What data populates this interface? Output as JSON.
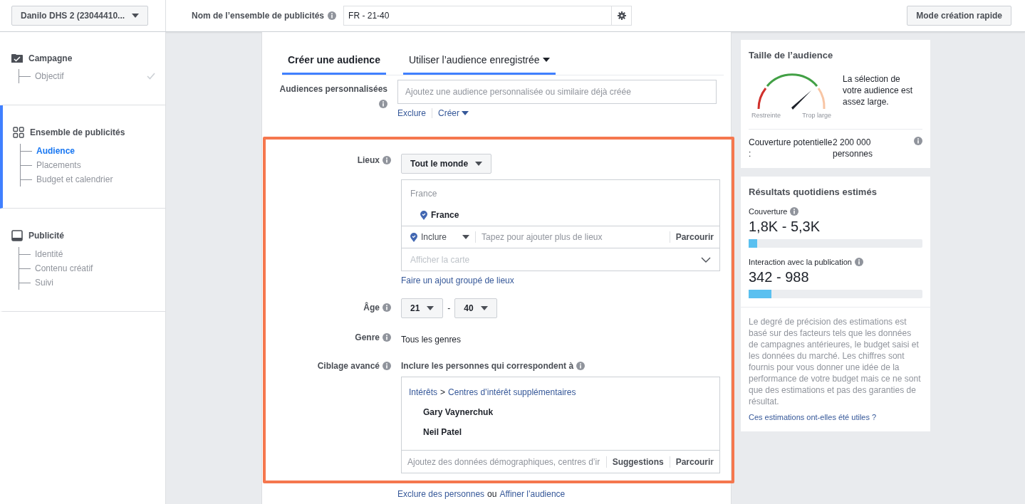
{
  "top_bar": {
    "account_selector": "Danilo DHS 2 (23044410...",
    "name_label": "Nom de l’ensemble de publicités",
    "name_value": "FR - 21-40",
    "quick_button": "Mode création rapide"
  },
  "sidebar": {
    "sections": [
      {
        "kind": "campaign",
        "title": "Campagne",
        "active": false,
        "items": [
          {
            "label": "Objectif",
            "selected": false,
            "done": true
          }
        ]
      },
      {
        "kind": "adset",
        "title": "Ensemble de publicités",
        "active": true,
        "items": [
          {
            "label": "Audience",
            "selected": true,
            "done": false
          },
          {
            "label": "Placements",
            "selected": false,
            "done": false
          },
          {
            "label": "Budget et calendrier",
            "selected": false,
            "done": false
          }
        ]
      },
      {
        "kind": "ad",
        "title": "Publicité",
        "active": false,
        "items": [
          {
            "label": "Identité",
            "selected": false,
            "done": false
          },
          {
            "label": "Contenu créatif",
            "selected": false,
            "done": false
          },
          {
            "label": "Suivi",
            "selected": false,
            "done": false
          }
        ]
      }
    ]
  },
  "audience": {
    "tabs": [
      {
        "label": "Créer une audience",
        "selected": true,
        "underlined": true,
        "dropdown": false
      },
      {
        "label": "Utiliser l’audience enregistrée",
        "selected": false,
        "underlined": true,
        "dropdown": true
      }
    ],
    "custom_audiences": {
      "label": "Audiences personnalisées",
      "placeholder": "Ajoutez une audience personnalisée ou similaire déjà créée",
      "exclude_link": "Exclure",
      "create_link": "Créer"
    },
    "locations": {
      "label": "Lieux",
      "dropdown": "Tout le monde",
      "group_header": "France",
      "selected_location": "France",
      "include": "Inclure",
      "placeholder": "Tapez pour ajouter plus de lieux",
      "browse": "Parcourir",
      "map": "Afficher la carte",
      "bulk_link": "Faire un ajout groupé de lieux"
    },
    "age": {
      "label": "Âge",
      "min": "21",
      "separator": "-",
      "max": "40"
    },
    "gender": {
      "label": "Genre",
      "value": "Tous les genres"
    },
    "detailed": {
      "label": "Ciblage avancé",
      "hint": "Inclure les personnes qui correspondent à",
      "category": "Intérêts",
      "breadcrumb_separator": ">",
      "subcategory": "Centres d’intérêt supplémentaires",
      "interests": [
        "Gary Vaynerchuk",
        "Neil Patel"
      ],
      "placeholder": "Ajoutez des données démographiques, centres d’ir",
      "suggestions": "Suggestions",
      "browse": "Parcourir"
    },
    "footer": {
      "exclude_link": "Exclure des personnes",
      "conjunction": "ou",
      "refine_link": "Affiner l’audience"
    }
  },
  "audience_size": {
    "title": "Taille de l’audience",
    "gauge_min_label": "Restreinte",
    "gauge_max_label": "Trop large",
    "message": "La sélection de votre audience est assez large.",
    "reach_label": "Couverture potentielle :",
    "reach_value": "2 200 000 personnes"
  },
  "daily_results": {
    "title": "Résultats quotidiens estimés",
    "metrics": [
      {
        "label": "Couverture",
        "value": "1,8K - 5,3K",
        "level": 0.05
      },
      {
        "label": "Interaction avec la publication",
        "value": "342 - 988",
        "level": 0.13
      }
    ],
    "disclaimer": "Le degré de précision des estimations est basé sur des facteurs tels que les données de campagnes antérieures, le budget saisi et les données du marché. Les chiffres sont fournis pour vous donner une idée de la performance de votre budget mais ce ne sont que des estimations et pas des garanties de résultat.",
    "feedback_link": "Ces estimations ont-elles été utiles ?"
  }
}
